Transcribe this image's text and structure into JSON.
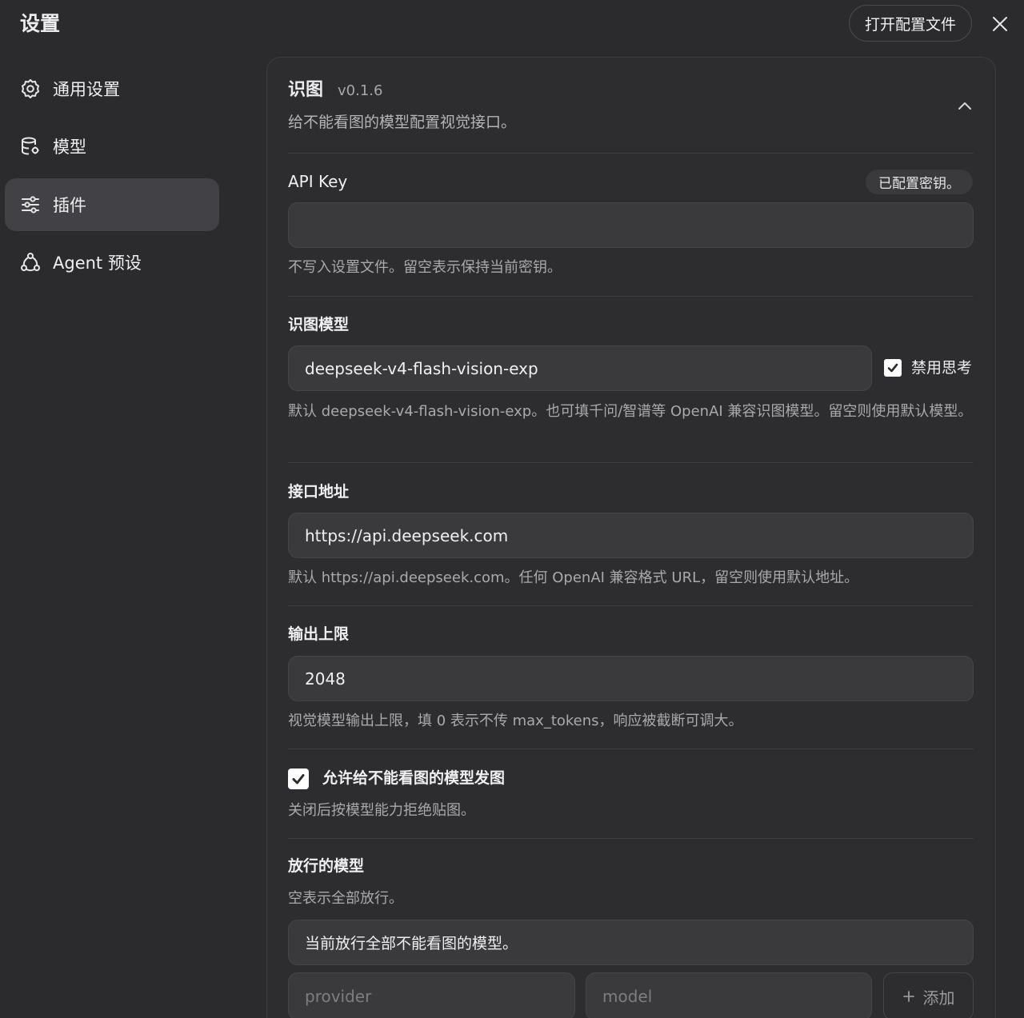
{
  "header": {
    "title": "设置",
    "open_config_label": "打开配置文件"
  },
  "sidebar": {
    "items": [
      {
        "label": "通用设置",
        "icon": "gear-icon"
      },
      {
        "label": "模型",
        "icon": "database-icon"
      },
      {
        "label": "插件",
        "icon": "sliders-icon",
        "active": true
      },
      {
        "label": "Agent 预设",
        "icon": "agent-icon"
      }
    ]
  },
  "plugin": {
    "name": "识图",
    "version": "v0.1.6",
    "description": "给不能看图的模型配置视觉接口。"
  },
  "api_key": {
    "label": "API Key",
    "badge": "已配置密钥。",
    "value": "",
    "hint": "不写入设置文件。留空表示保持当前密钥。"
  },
  "vision_model": {
    "label": "识图模型",
    "value": "deepseek-v4-flash-vision-exp",
    "disable_thinking_label": "禁用思考",
    "disable_thinking_checked": true,
    "hint": "默认 deepseek-v4-flash-vision-exp。也可填千问/智谱等 OpenAI 兼容识图模型。留空则使用默认模型。"
  },
  "endpoint": {
    "label": "接口地址",
    "value": "https://api.deepseek.com",
    "hint": "默认 https://api.deepseek.com。任何 OpenAI 兼容格式 URL，留空则使用默认地址。"
  },
  "max_output": {
    "label": "输出上限",
    "value": "2048",
    "hint": "视觉模型输出上限，填 0 表示不传 max_tokens，响应被截断可调大。"
  },
  "allow_images": {
    "label": "允许给不能看图的模型发图",
    "checked": true,
    "hint": "关闭后按模型能力拒绝贴图。"
  },
  "allowed_models": {
    "label": "放行的模型",
    "hint": "空表示全部放行。",
    "status": "当前放行全部不能看图的模型。",
    "provider_placeholder": "provider",
    "model_placeholder": "model",
    "add_label": "添加"
  },
  "colors": {
    "background": "#2b2b2d",
    "active_nav": "#424246",
    "field": "#3a3a3d",
    "text": "#ececee",
    "muted": "#a9a9ae"
  }
}
